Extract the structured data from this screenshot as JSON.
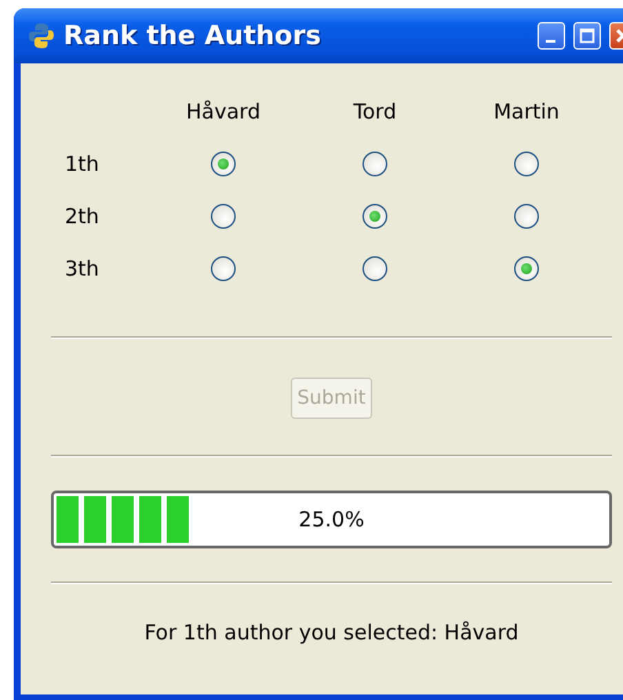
{
  "window": {
    "title": "Rank the Authors"
  },
  "columns": [
    "Håvard",
    "Tord",
    "Martin"
  ],
  "rows": [
    {
      "label": "1th",
      "options": [
        {
          "selected": true
        },
        {
          "selected": false
        },
        {
          "selected": false
        }
      ]
    },
    {
      "label": "2th",
      "options": [
        {
          "selected": false
        },
        {
          "selected": true
        },
        {
          "selected": false
        }
      ]
    },
    {
      "label": "3th",
      "options": [
        {
          "selected": false
        },
        {
          "selected": false
        },
        {
          "selected": true
        }
      ]
    }
  ],
  "submit": {
    "label": "Submit",
    "disabled": true
  },
  "progress": {
    "level": 0.25,
    "reading": "25.0%"
  },
  "status": "For 1th author you selected: Håvard"
}
